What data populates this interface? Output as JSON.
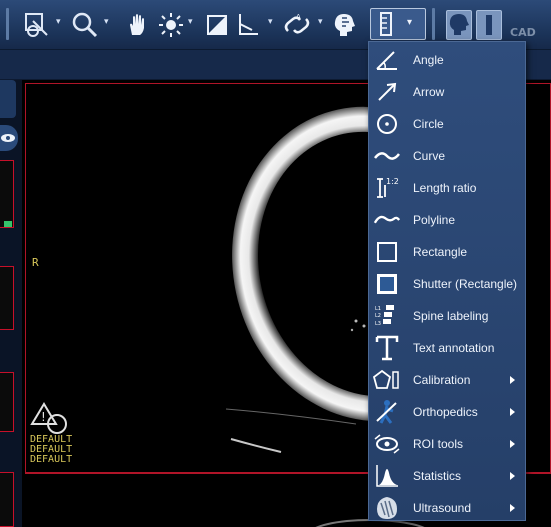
{
  "toolbar": {
    "cad_label": "CAD"
  },
  "viewport": {
    "orientation_label": "R",
    "preset_lines": [
      "DEFAULT",
      "DEFAULT",
      "DEFAULT"
    ]
  },
  "menu": {
    "items": [
      {
        "label": "Angle",
        "icon": "angle-icon",
        "has_submenu": false
      },
      {
        "label": "Arrow",
        "icon": "arrow-icon",
        "has_submenu": false
      },
      {
        "label": "Circle",
        "icon": "circle-icon",
        "has_submenu": false
      },
      {
        "label": "Curve",
        "icon": "curve-icon",
        "has_submenu": false
      },
      {
        "label": "Length ratio",
        "icon": "length-ratio-icon",
        "has_submenu": false
      },
      {
        "label": "Polyline",
        "icon": "polyline-icon",
        "has_submenu": false
      },
      {
        "label": "Rectangle",
        "icon": "rectangle-icon",
        "has_submenu": false
      },
      {
        "label": "Shutter (Rectangle)",
        "icon": "shutter-icon",
        "has_submenu": false
      },
      {
        "label": "Spine labeling",
        "icon": "spine-icon",
        "has_submenu": false
      },
      {
        "label": "Text annotation",
        "icon": "text-icon",
        "has_submenu": false
      },
      {
        "label": "Calibration",
        "icon": "calibration-icon",
        "has_submenu": true
      },
      {
        "label": "Orthopedics",
        "icon": "orthopedics-icon",
        "has_submenu": true
      },
      {
        "label": "ROI tools",
        "icon": "roi-icon",
        "has_submenu": true
      },
      {
        "label": "Statistics",
        "icon": "statistics-icon",
        "has_submenu": true
      },
      {
        "label": "Ultrasound",
        "icon": "ultrasound-icon",
        "has_submenu": true
      }
    ]
  },
  "colors": {
    "toolbar_bg": "#1b3358",
    "menu_bg": "#2f4d7c",
    "viewport_border": "#b01428",
    "overlay_text": "#d8c75a"
  }
}
